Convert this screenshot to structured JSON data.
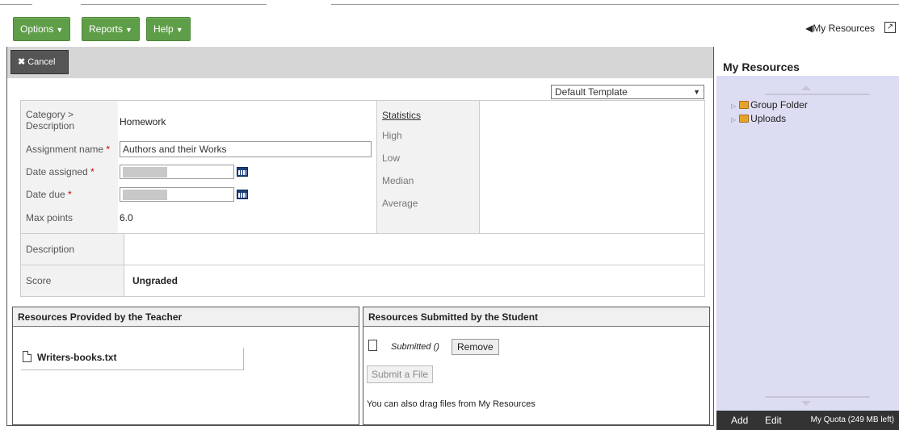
{
  "menus": {
    "options": "Options",
    "reports": "Reports",
    "help": "Help"
  },
  "header": {
    "my_resources_link": "◀My Resources"
  },
  "toolbar": {
    "cancel": "Cancel"
  },
  "template": {
    "selected": "Default Template"
  },
  "form": {
    "category_label": "Category > Description",
    "category_value": "Homework",
    "assignment_label": "Assignment name",
    "assignment_value": "Authors and their Works",
    "date_assigned_label": "Date assigned",
    "date_due_label": "Date due",
    "max_points_label": "Max points",
    "max_points_value": "6.0",
    "description_label": "Description",
    "score_label": "Score",
    "score_value": "Ungraded",
    "required_mark": "*"
  },
  "stats": {
    "title": "Statistics",
    "high": "High",
    "low": "Low",
    "median": "Median",
    "average": "Average"
  },
  "teacher_resources": {
    "title": "Resources Provided by the Teacher",
    "file": "Writers-books.txt"
  },
  "student_resources": {
    "title": "Resources Submitted by the Student",
    "submitted": "Submitted ()",
    "remove": "Remove",
    "submit_file": "Submit a File",
    "drag_note": "You can also drag files from My Resources"
  },
  "my_resources": {
    "title": "My Resources",
    "items": [
      "Group Folder",
      "Uploads"
    ],
    "add": "Add",
    "edit": "Edit",
    "quota": "My Quota (249 MB left)"
  },
  "colors": {
    "menu_green": "#5f9e48",
    "resources_bg": "#dcdcf2",
    "footer_dark": "#333333"
  }
}
